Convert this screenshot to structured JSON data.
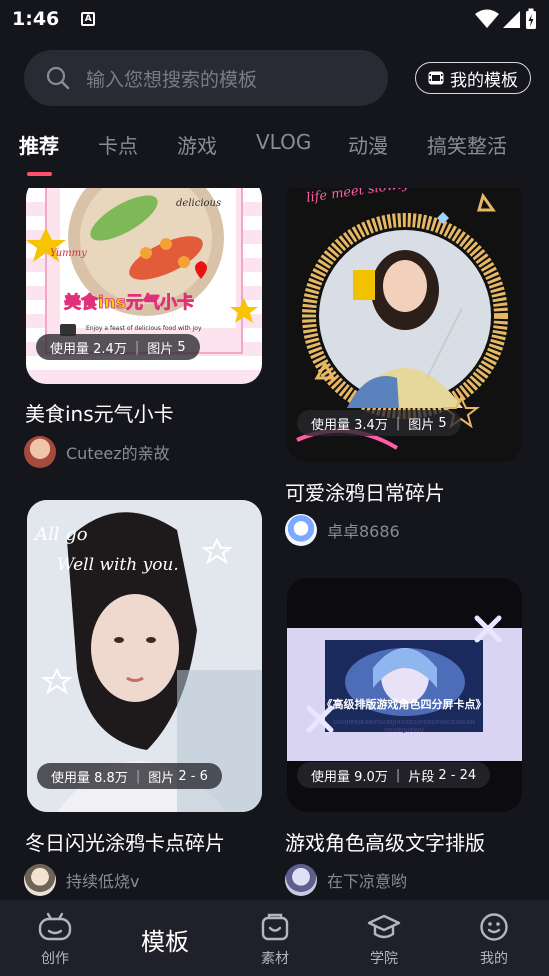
{
  "status_bar": {
    "time": "1:46",
    "notice_letter": "A"
  },
  "search": {
    "placeholder": "输入您想搜索的模板"
  },
  "my_templates_label": "我的模板",
  "tabs": [
    {
      "label": "推荐",
      "active": true
    },
    {
      "label": "卡点"
    },
    {
      "label": "游戏"
    },
    {
      "label": "VLOG"
    },
    {
      "label": "动漫"
    },
    {
      "label": "搞笑整活"
    }
  ],
  "cards": [
    {
      "title": "美食ins元气小卡",
      "usage_label": "使用量",
      "usage_value": "2.4万",
      "count_label": "图片",
      "count_value": "5",
      "author": "Cuteez的亲故"
    },
    {
      "title": "可爱涂鸦日常碎片",
      "usage_label": "使用量",
      "usage_value": "3.4万",
      "count_label": "图片",
      "count_value": "5",
      "author": "卓卓8686"
    },
    {
      "title": "冬日闪光涂鸦卡点碎片",
      "usage_label": "使用量",
      "usage_value": "8.8万",
      "count_label": "图片",
      "count_value": "2 - 6",
      "author": "持续低烧v"
    },
    {
      "title": "游戏角色高级文字排版",
      "usage_label": "使用量",
      "usage_value": "9.0万",
      "count_label": "片段",
      "count_value": "2 - 24",
      "author": "在下凉意哟"
    }
  ],
  "thumb_text": {
    "food_banner": "美食ins元气小卡",
    "food_yummy": "Yummy",
    "food_delicious": "delicious",
    "food_caption": "Enjoy a feast of delicious food with joy",
    "doodle_script": "life meet slowly",
    "winter_script1": "All go",
    "winter_script2": "Well with you.",
    "game_banner": "《高级排版游戏角色四分屏卡点》",
    "game_sub1": "GAOJIPAIBANYOUXIJIAOSESIFENGPINGKADIAN",
    "game_sub2": "YOUXIJUEWU"
  },
  "bottom_nav": [
    {
      "label": "创作"
    },
    {
      "label": "模板",
      "active": true
    },
    {
      "label": "素材"
    },
    {
      "label": "学院"
    },
    {
      "label": "我的"
    }
  ],
  "colors": {
    "background": "#15151c",
    "accent": "#ff4f6b",
    "search_bg": "#2a2a35"
  }
}
